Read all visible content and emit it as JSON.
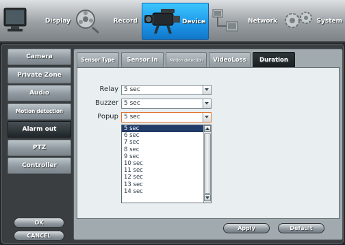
{
  "top_tabs": [
    {
      "label": "Display",
      "icon": "monitor-icon"
    },
    {
      "label": "Record",
      "icon": "record-reel-icon"
    },
    {
      "label": "Device",
      "icon": "camcorder-icon",
      "active": true
    },
    {
      "label": "Network",
      "icon": "network-icon"
    },
    {
      "label": "System",
      "icon": "gears-icon"
    }
  ],
  "left_menu": [
    {
      "label": "Camera"
    },
    {
      "label": "Private Zone"
    },
    {
      "label": "Audio"
    },
    {
      "label": "Motion detection"
    },
    {
      "label": "Alarm out",
      "active": true
    },
    {
      "label": "PTZ"
    },
    {
      "label": "Controller"
    }
  ],
  "left_buttons": {
    "ok": "OK",
    "cancel": "CANCEL"
  },
  "sub_tabs": [
    {
      "label": "Sensor Type"
    },
    {
      "label": "Sensor In"
    },
    {
      "label": "Motion detection"
    },
    {
      "label": "VideoLoss"
    },
    {
      "label": "Duration",
      "active": true
    }
  ],
  "fields": {
    "relay": {
      "label": "Relay",
      "value": "5 sec"
    },
    "buzzer": {
      "label": "Buzzer",
      "value": "5 sec"
    },
    "popup": {
      "label": "Popup",
      "value": "5 sec"
    }
  },
  "dropdown_options": [
    "5 sec",
    "6 sec",
    "7 sec",
    "8 sec",
    "9 sec",
    "10 sec",
    "11 sec",
    "12 sec",
    "13 sec",
    "14 sec"
  ],
  "dropdown_selected": "5 sec",
  "bottom_buttons": {
    "apply": "Apply",
    "default": "Default"
  },
  "colors": {
    "accent": "#1b95e8",
    "selection": "#223c6a",
    "focus_border": "#e0712c"
  }
}
